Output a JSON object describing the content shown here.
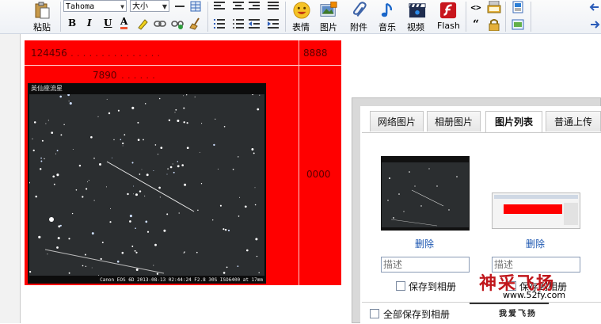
{
  "toolbar": {
    "paste_label": "粘贴",
    "font_family": "Tahoma",
    "font_size": "大小",
    "bold": "B",
    "italic": "I",
    "underline": "U",
    "font_color": "A",
    "emoticon_label": "表情",
    "image_label": "图片",
    "attachment_label": "附件",
    "music_label": "音乐",
    "video_label": "视频",
    "flash_label": "Flash"
  },
  "editor": {
    "cell_a1": "124456",
    "cell_b1": "8888",
    "cell_a2": "7890",
    "cell_b2": "0000",
    "photo_caption_top": "英仙座流星",
    "photo_caption_bottom": "Canon EOS 6D 2013-08-13 02:44:24 F2.8 30S ISO6400 at 17mm"
  },
  "dialog": {
    "tabs": [
      {
        "label": "网络图片",
        "active": false
      },
      {
        "label": "相册图片",
        "active": false
      },
      {
        "label": "图片列表",
        "active": true
      },
      {
        "label": "普通上传",
        "active": false
      }
    ],
    "items": [
      {
        "delete_label": "删除",
        "desc_placeholder": "描述",
        "save_label": "保存到相册"
      },
      {
        "delete_label": "删除",
        "desc_placeholder": "描述",
        "save_label": "保存到相册"
      }
    ],
    "save_all_label": "全部保存到相册"
  },
  "watermark": {
    "title": "神采飞扬",
    "url": "www.52fy.com",
    "subtitle": "我爱飞扬"
  },
  "colors": {
    "table_red": "#ff0000",
    "link_blue": "#1a55b0",
    "watermark_red": "#c0161b"
  }
}
